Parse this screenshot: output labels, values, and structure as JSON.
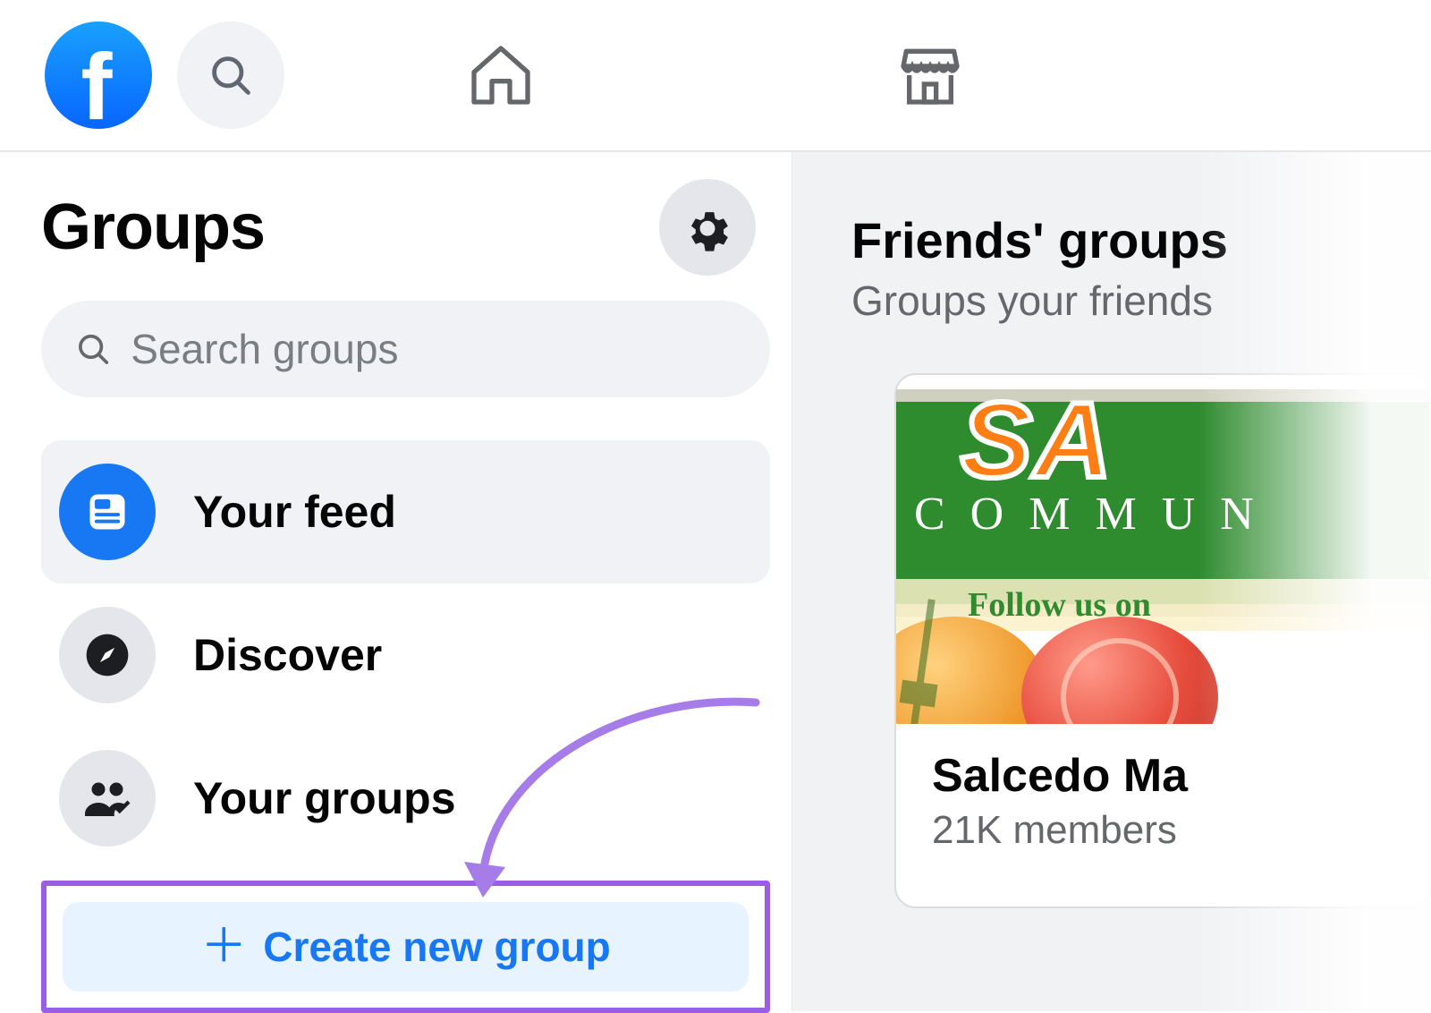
{
  "sidebar": {
    "title": "Groups",
    "search_placeholder": "Search groups",
    "items": [
      {
        "label": "Your feed"
      },
      {
        "label": "Discover"
      },
      {
        "label": "Your groups"
      }
    ],
    "create_label": "Create new group"
  },
  "main": {
    "heading": "Friends' groups",
    "subheading": "Groups your friends",
    "card": {
      "banner_word1": "SA",
      "banner_word2": "COMMUN",
      "banner_follow": "Follow us on",
      "title": "Salcedo Ma",
      "subtitle": "21K members"
    }
  }
}
